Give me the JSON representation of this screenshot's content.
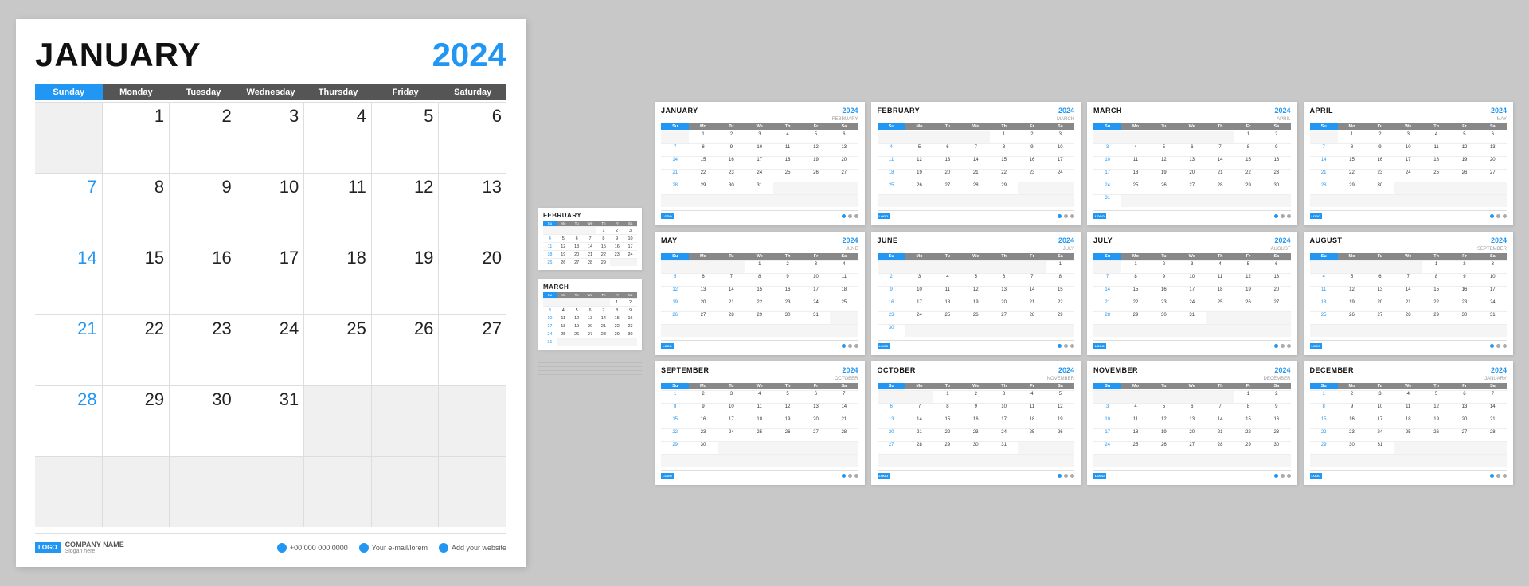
{
  "large_calendar": {
    "month": "JANUARY",
    "year": "2024",
    "day_headers": [
      "Sunday",
      "Monday",
      "Tuesday",
      "Wednesday",
      "Thursday",
      "Friday",
      "Saturday"
    ],
    "weeks": [
      [
        "",
        "1",
        "2",
        "3",
        "4",
        "5",
        "6"
      ],
      [
        "7",
        "8",
        "9",
        "10",
        "11",
        "12",
        "13"
      ],
      [
        "14",
        "15",
        "16",
        "17",
        "18",
        "19",
        "20"
      ],
      [
        "21",
        "22",
        "23",
        "24",
        "25",
        "26",
        "27"
      ],
      [
        "28",
        "29",
        "30",
        "31",
        "",
        "",
        ""
      ],
      [
        "",
        "",
        "",
        "",
        "",
        "",
        ""
      ]
    ],
    "footer": {
      "logo": "LOGO",
      "company": "COMPANY NAME",
      "slogan": "Slogan here",
      "phone_icon": "phone",
      "phone": "+00 000 000 0000",
      "email_icon": "email",
      "email": "Your e-mail/lorem",
      "web_icon": "web",
      "website": "Add your website"
    }
  },
  "side_calendars": [
    {
      "month": "FEBRUARY",
      "weeks": [
        [
          "",
          "",
          "",
          "",
          "1",
          "2",
          "3"
        ],
        [
          "4",
          "5",
          "6",
          "7",
          "8",
          "9",
          "10"
        ],
        [
          "11",
          "12",
          "13",
          "14",
          "15",
          "16",
          "17"
        ],
        [
          "18",
          "19",
          "20",
          "21",
          "22",
          "23",
          "24"
        ],
        [
          "25",
          "26",
          "27",
          "28",
          "29",
          "",
          ""
        ]
      ]
    },
    {
      "month": "MARCH",
      "weeks": [
        [
          "",
          "",
          "",
          "",
          "",
          "1",
          "2"
        ],
        [
          "3",
          "4",
          "5",
          "6",
          "7",
          "8",
          "9"
        ],
        [
          "10",
          "11",
          "12",
          "13",
          "14",
          "15",
          "16"
        ],
        [
          "17",
          "18",
          "19",
          "20",
          "21",
          "22",
          "23"
        ],
        [
          "24",
          "25",
          "26",
          "27",
          "28",
          "29",
          "30"
        ],
        [
          "31",
          "",
          "",
          "",
          "",
          "",
          ""
        ]
      ]
    }
  ],
  "mini_calendars": [
    {
      "month": "JANUARY",
      "year": "2024",
      "next_label": "FEBRUARY",
      "weeks": [
        [
          "",
          "1",
          "2",
          "3",
          "4",
          "5",
          "6"
        ],
        [
          "7",
          "8",
          "9",
          "10",
          "11",
          "12",
          "13"
        ],
        [
          "14",
          "15",
          "16",
          "17",
          "18",
          "19",
          "20"
        ],
        [
          "21",
          "22",
          "23",
          "24",
          "25",
          "26",
          "27"
        ],
        [
          "28",
          "29",
          "30",
          "31",
          "",
          "",
          ""
        ],
        [
          "",
          "",
          "",
          "",
          "",
          "",
          ""
        ]
      ]
    },
    {
      "month": "FEBRUARY",
      "year": "2024",
      "next_label": "MARCH",
      "weeks": [
        [
          "",
          "",
          "",
          "",
          "1",
          "2",
          "3"
        ],
        [
          "4",
          "5",
          "6",
          "7",
          "8",
          "9",
          "10"
        ],
        [
          "11",
          "12",
          "13",
          "14",
          "15",
          "16",
          "17"
        ],
        [
          "18",
          "19",
          "20",
          "21",
          "22",
          "23",
          "24"
        ],
        [
          "25",
          "26",
          "27",
          "28",
          "29",
          "",
          ""
        ],
        [
          "",
          "",
          "",
          "",
          "",
          "",
          ""
        ]
      ]
    },
    {
      "month": "MARCH",
      "year": "2024",
      "next_label": "APRIL",
      "weeks": [
        [
          "",
          "",
          "",
          "",
          "",
          "1",
          "2"
        ],
        [
          "3",
          "4",
          "5",
          "6",
          "7",
          "8",
          "9"
        ],
        [
          "10",
          "11",
          "12",
          "13",
          "14",
          "15",
          "16"
        ],
        [
          "17",
          "18",
          "19",
          "20",
          "21",
          "22",
          "23"
        ],
        [
          "24",
          "25",
          "26",
          "27",
          "28",
          "29",
          "30"
        ],
        [
          "31",
          "",
          "",
          "",
          "",
          "",
          ""
        ]
      ]
    },
    {
      "month": "APRIL",
      "year": "2024",
      "next_label": "MAY",
      "weeks": [
        [
          "",
          "1",
          "2",
          "3",
          "4",
          "5",
          "6"
        ],
        [
          "7",
          "8",
          "9",
          "10",
          "11",
          "12",
          "13"
        ],
        [
          "14",
          "15",
          "16",
          "17",
          "18",
          "19",
          "20"
        ],
        [
          "21",
          "22",
          "23",
          "24",
          "25",
          "26",
          "27"
        ],
        [
          "28",
          "29",
          "30",
          "",
          "",
          "",
          ""
        ],
        [
          "",
          "",
          "",
          "",
          "",
          "",
          ""
        ]
      ]
    },
    {
      "month": "MAY",
      "year": "2024",
      "next_label": "JUNE",
      "weeks": [
        [
          "",
          "",
          "",
          "1",
          "2",
          "3",
          "4"
        ],
        [
          "5",
          "6",
          "7",
          "8",
          "9",
          "10",
          "11"
        ],
        [
          "12",
          "13",
          "14",
          "15",
          "16",
          "17",
          "18"
        ],
        [
          "19",
          "20",
          "21",
          "22",
          "23",
          "24",
          "25"
        ],
        [
          "26",
          "27",
          "28",
          "29",
          "30",
          "31",
          ""
        ],
        [
          "",
          "",
          "",
          "",
          "",
          "",
          ""
        ]
      ]
    },
    {
      "month": "JUNE",
      "year": "2024",
      "next_label": "JULY",
      "weeks": [
        [
          "",
          "",
          "",
          "",
          "",
          "",
          "1"
        ],
        [
          "2",
          "3",
          "4",
          "5",
          "6",
          "7",
          "8"
        ],
        [
          "9",
          "10",
          "11",
          "12",
          "13",
          "14",
          "15"
        ],
        [
          "16",
          "17",
          "18",
          "19",
          "20",
          "21",
          "22"
        ],
        [
          "23",
          "24",
          "25",
          "26",
          "27",
          "28",
          "29"
        ],
        [
          "30",
          "",
          "",
          "",
          "",
          "",
          ""
        ]
      ]
    },
    {
      "month": "JULY",
      "year": "2024",
      "next_label": "AUGUST",
      "weeks": [
        [
          "",
          "1",
          "2",
          "3",
          "4",
          "5",
          "6"
        ],
        [
          "7",
          "8",
          "9",
          "10",
          "11",
          "12",
          "13"
        ],
        [
          "14",
          "15",
          "16",
          "17",
          "18",
          "19",
          "20"
        ],
        [
          "21",
          "22",
          "23",
          "24",
          "25",
          "26",
          "27"
        ],
        [
          "28",
          "29",
          "30",
          "31",
          "",
          "",
          ""
        ],
        [
          "",
          "",
          "",
          "",
          "",
          "",
          ""
        ]
      ]
    },
    {
      "month": "AUGUST",
      "year": "2024",
      "next_label": "SEPTEMBER",
      "weeks": [
        [
          "",
          "",
          "",
          "",
          "1",
          "2",
          "3"
        ],
        [
          "4",
          "5",
          "6",
          "7",
          "8",
          "9",
          "10"
        ],
        [
          "11",
          "12",
          "13",
          "14",
          "15",
          "16",
          "17"
        ],
        [
          "18",
          "19",
          "20",
          "21",
          "22",
          "23",
          "24"
        ],
        [
          "25",
          "26",
          "27",
          "28",
          "29",
          "30",
          "31"
        ],
        [
          "",
          "",
          "",
          "",
          "",
          "",
          ""
        ]
      ]
    },
    {
      "month": "SEPTEMBER",
      "year": "2024",
      "next_label": "OCTOBER",
      "weeks": [
        [
          "1",
          "2",
          "3",
          "4",
          "5",
          "6",
          "7"
        ],
        [
          "8",
          "9",
          "10",
          "11",
          "12",
          "13",
          "14"
        ],
        [
          "15",
          "16",
          "17",
          "18",
          "19",
          "20",
          "21"
        ],
        [
          "22",
          "23",
          "24",
          "25",
          "26",
          "27",
          "28"
        ],
        [
          "29",
          "30",
          "",
          "",
          "",
          "",
          ""
        ],
        [
          "",
          "",
          "",
          "",
          "",
          "",
          ""
        ]
      ]
    },
    {
      "month": "OCTOBER",
      "year": "2024",
      "next_label": "NOVEMBER",
      "weeks": [
        [
          "",
          "",
          "1",
          "2",
          "3",
          "4",
          "5"
        ],
        [
          "6",
          "7",
          "8",
          "9",
          "10",
          "11",
          "12"
        ],
        [
          "13",
          "14",
          "15",
          "16",
          "17",
          "18",
          "19"
        ],
        [
          "20",
          "21",
          "22",
          "23",
          "24",
          "25",
          "26"
        ],
        [
          "27",
          "28",
          "29",
          "30",
          "31",
          "",
          ""
        ],
        [
          "",
          "",
          "",
          "",
          "",
          "",
          ""
        ]
      ]
    },
    {
      "month": "NOVEMBER",
      "year": "2024",
      "next_label": "DECEMBER",
      "weeks": [
        [
          "",
          "",
          "",
          "",
          "",
          "1",
          "2"
        ],
        [
          "3",
          "4",
          "5",
          "6",
          "7",
          "8",
          "9"
        ],
        [
          "10",
          "11",
          "12",
          "13",
          "14",
          "15",
          "16"
        ],
        [
          "17",
          "18",
          "19",
          "20",
          "21",
          "22",
          "23"
        ],
        [
          "24",
          "25",
          "26",
          "27",
          "28",
          "29",
          "30"
        ],
        [
          "",
          "",
          "",
          "",
          "",
          "",
          ""
        ]
      ]
    },
    {
      "month": "DECEMBER",
      "year": "2024",
      "next_label": "JANUARY",
      "weeks": [
        [
          "1",
          "2",
          "3",
          "4",
          "5",
          "6",
          "7"
        ],
        [
          "8",
          "9",
          "10",
          "11",
          "12",
          "13",
          "14"
        ],
        [
          "15",
          "16",
          "17",
          "18",
          "19",
          "20",
          "21"
        ],
        [
          "22",
          "23",
          "24",
          "25",
          "26",
          "27",
          "28"
        ],
        [
          "29",
          "30",
          "31",
          "",
          "",
          "",
          ""
        ],
        [
          "",
          "",
          "",
          "",
          "",
          "",
          ""
        ]
      ]
    }
  ],
  "day_headers_short": [
    "Su",
    "Mo",
    "Tu",
    "We",
    "Th",
    "Fr",
    "Sa"
  ]
}
